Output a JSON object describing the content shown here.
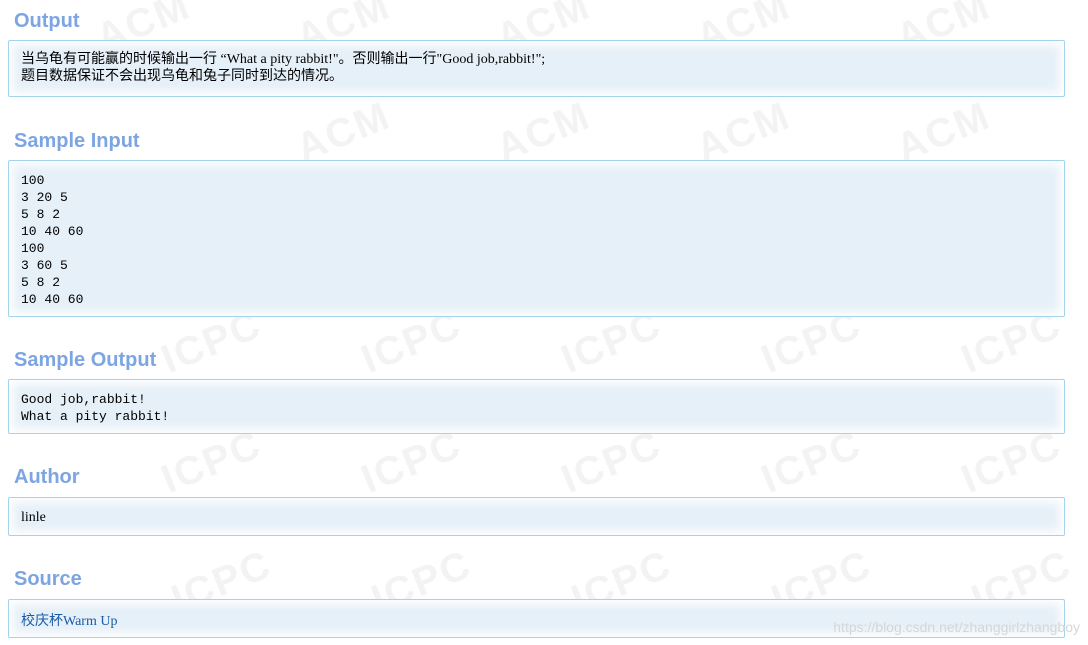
{
  "output": {
    "heading": "Output",
    "lines": [
      "当乌龟有可能赢的时候输出一行 “What a pity rabbit!\"。否则输出一行\"Good job,rabbit!\";",
      "题目数据保证不会出现乌龟和兔子同时到达的情况。"
    ]
  },
  "sample_input": {
    "heading": "Sample Input",
    "lines": [
      "100",
      "3 20 5",
      "5 8 2",
      "10 40 60",
      "100",
      "3 60 5",
      "5 8 2",
      "10 40 60"
    ]
  },
  "sample_output": {
    "heading": "Sample Output",
    "lines": [
      "Good job,rabbit!",
      "What a pity rabbit!"
    ]
  },
  "author": {
    "heading": "Author",
    "value": "linle"
  },
  "source": {
    "heading": "Source",
    "link_text": "校庆杯Warm Up"
  },
  "watermark": {
    "text_cpc": "ICPC",
    "text_acm": "ACM",
    "csdn": "https://blog.csdn.net/zhanggirlzhangboy"
  },
  "colors": {
    "heading": "#7ca5e2",
    "box_bg": "#e6f0f8",
    "box_border": "#a3d4ee",
    "link": "#1a5aa8"
  }
}
